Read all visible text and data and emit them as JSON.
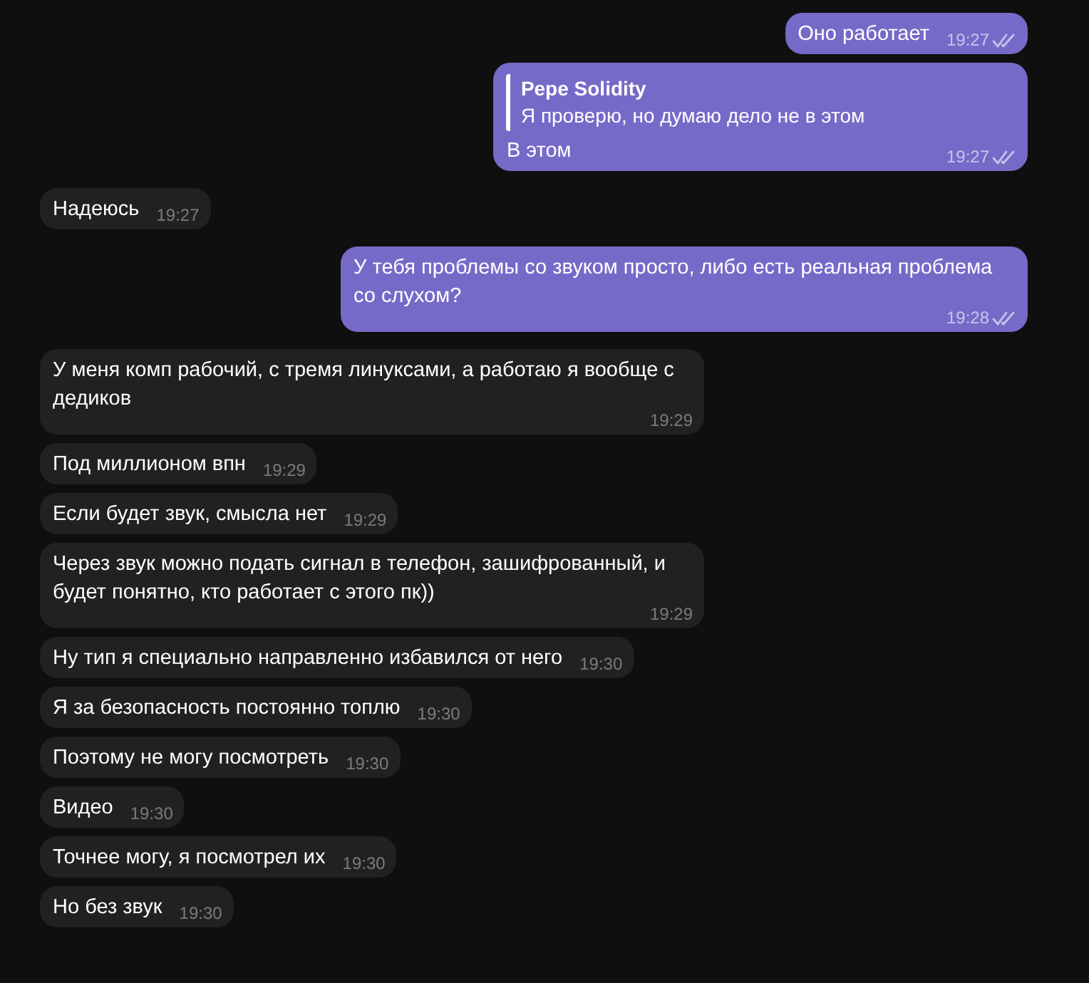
{
  "messages": [
    {
      "kind": "outgoing",
      "text": "Оно работает",
      "time": "19:27",
      "read": true
    },
    {
      "kind": "outgoing",
      "reply": {
        "author": "Pepe Solidity",
        "text": "Я проверю, но думаю дело не в этом"
      },
      "text": "В этом",
      "time": "19:27",
      "read": true
    },
    {
      "kind": "incoming",
      "text": "Надеюсь",
      "time": "19:27"
    },
    {
      "kind": "outgoing",
      "text": "У тебя проблемы со звуком просто, либо есть реальная проблема со слухом?",
      "time": "19:28",
      "read": true
    },
    {
      "kind": "incoming",
      "text": "У меня комп рабочий, с тремя линуксами, а работаю я вообще с дедиков",
      "time": "19:29"
    },
    {
      "kind": "incoming",
      "text": "Под миллионом впн",
      "time": "19:29"
    },
    {
      "kind": "incoming",
      "text": "Если будет звук, смысла нет",
      "time": "19:29"
    },
    {
      "kind": "incoming",
      "text": "Через звук можно подать сигнал в телефон, зашифрованный, и будет понятно, кто работает с этого пк))",
      "time": "19:29"
    },
    {
      "kind": "incoming",
      "text": "Ну тип я специально направленно избавился от него",
      "time": "19:30"
    },
    {
      "kind": "incoming",
      "text": "Я за безопасность постоянно топлю",
      "time": "19:30"
    },
    {
      "kind": "incoming",
      "text": "Поэтому не могу посмотреть",
      "time": "19:30"
    },
    {
      "kind": "incoming",
      "text": "Видео",
      "time": "19:30"
    },
    {
      "kind": "incoming",
      "text": "Точнее могу, я посмотрел их",
      "time": "19:30"
    },
    {
      "kind": "incoming",
      "text": "Но без звук",
      "time": "19:30"
    }
  ]
}
